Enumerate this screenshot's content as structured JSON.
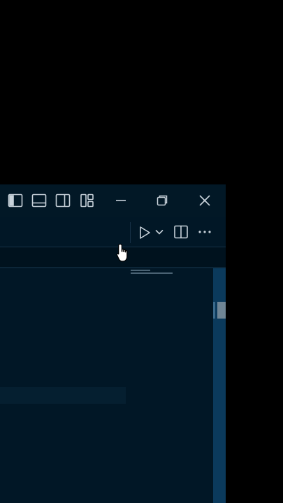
{
  "colors": {
    "desktop": "#000000",
    "window_background": "#011726",
    "titlebar_background": "#021826",
    "icon_color": "#c8d2da",
    "scrollbar": "#0b3a5c",
    "scroll_thumb": "#6f8595"
  },
  "titlebar": {
    "layout_controls": [
      {
        "name": "toggle-primary-sidebar",
        "icon": "sidebar-left-icon"
      },
      {
        "name": "toggle-panel",
        "icon": "panel-bottom-icon"
      },
      {
        "name": "toggle-secondary-sidebar",
        "icon": "sidebar-right-icon"
      },
      {
        "name": "customize-layout",
        "icon": "layout-grid-icon"
      }
    ],
    "window_controls": [
      {
        "name": "minimize",
        "icon": "minimize-icon"
      },
      {
        "name": "restore",
        "icon": "restore-icon"
      },
      {
        "name": "close",
        "icon": "close-icon"
      }
    ]
  },
  "editor_toolbar": {
    "actions": [
      {
        "name": "run",
        "icon": "play-icon"
      },
      {
        "name": "run-options",
        "icon": "chevron-down-icon"
      },
      {
        "name": "split-editor",
        "icon": "split-editor-icon"
      },
      {
        "name": "more-actions",
        "icon": "more-horizontal-icon"
      }
    ]
  },
  "cursor": {
    "icon": "hand-pointer-icon"
  }
}
